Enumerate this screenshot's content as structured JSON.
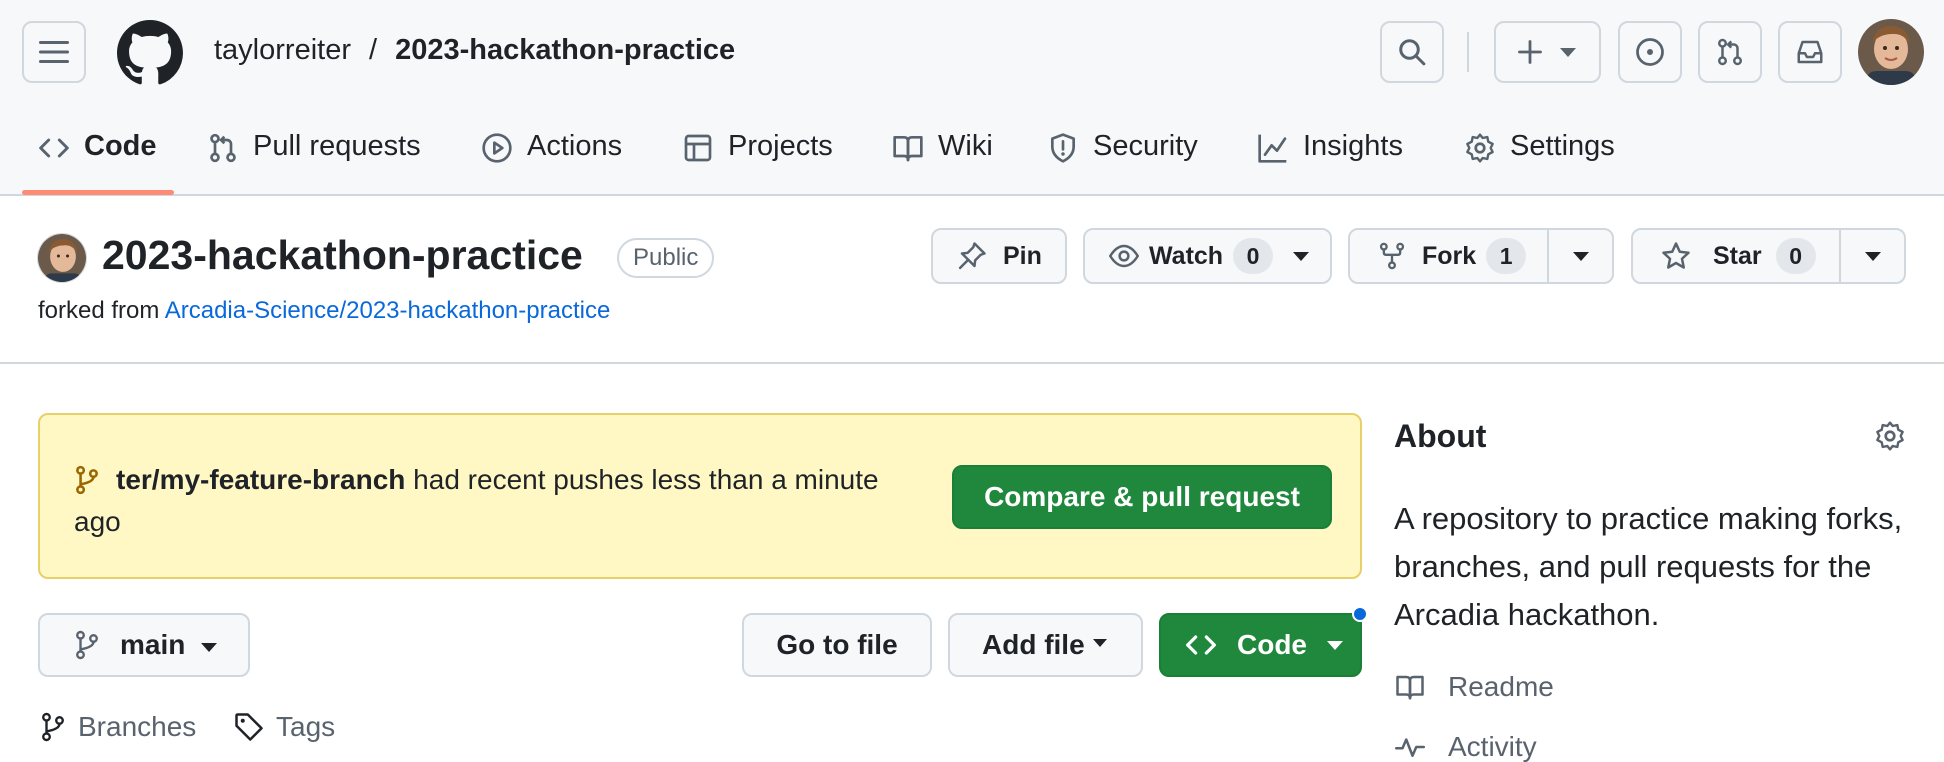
{
  "header": {
    "owner": "taylorreiter",
    "separator": "/",
    "repo": "2023-hackathon-practice"
  },
  "nav": {
    "items": [
      {
        "label": "Code",
        "icon": "code-icon",
        "active": true
      },
      {
        "label": "Pull requests",
        "icon": "git-pull-request-icon"
      },
      {
        "label": "Actions",
        "icon": "play-icon"
      },
      {
        "label": "Projects",
        "icon": "table-icon"
      },
      {
        "label": "Wiki",
        "icon": "book-icon"
      },
      {
        "label": "Security",
        "icon": "shield-icon"
      },
      {
        "label": "Insights",
        "icon": "graph-icon"
      },
      {
        "label": "Settings",
        "icon": "gear-icon"
      }
    ]
  },
  "repo": {
    "title": "2023-hackathon-practice",
    "visibility": "Public",
    "forked_prefix": "forked from",
    "forked_source": "Arcadia-Science/2023-hackathon-practice"
  },
  "actions": {
    "pin": "Pin",
    "watch": "Watch",
    "watch_count": "0",
    "fork": "Fork",
    "fork_count": "1",
    "star": "Star",
    "star_count": "0"
  },
  "banner": {
    "branch": "ter/my-feature-branch",
    "message": " had recent pushes less than a minute ago",
    "button": "Compare & pull request"
  },
  "filenav": {
    "branch": "main",
    "go_to_file": "Go to file",
    "add_file": "Add file",
    "code": "Code",
    "branches": "Branches",
    "tags": "Tags"
  },
  "about": {
    "title": "About",
    "description": "A repository to practice making forks, branches, and pull requests for the Arcadia hackathon.",
    "readme": "Readme",
    "activity": "Activity"
  },
  "colors": {
    "accent_green": "#1f883d",
    "link_blue": "#0969da",
    "banner_bg": "#fff8c5",
    "nav_underline": "#fd8c73"
  }
}
